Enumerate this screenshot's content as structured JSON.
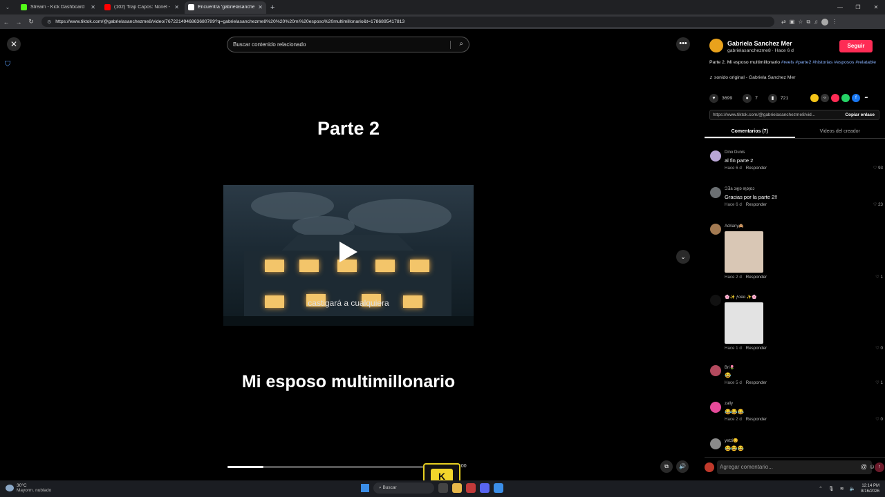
{
  "browser": {
    "tabs": [
      {
        "title": "Stream - Kick Dashboard",
        "color": "#53fc18",
        "active": false
      },
      {
        "title": "(102) Trap Capos: Noriel - Quie",
        "color": "#ff0000",
        "active": false
      },
      {
        "title": "Encuentra 'gabrielasanchezme8",
        "color": "#ffffff",
        "active": true
      }
    ],
    "url": "https://www.tiktok.com/@gabrielasanchezme8/video/7672214946863680789?q=gabrielasanchezme8%20%20%20mi%20esposo%20multimillonario&t=1786895417813"
  },
  "page": {
    "search_placeholder": "Buscar contenido relacionado",
    "video": {
      "title_top": "Parte 2",
      "subtitle": "castigará a cualquiera",
      "title_bottom": "Mi esposo multimillonario",
      "progress": 0.18,
      "time": "2:00"
    },
    "kick_badge": "K"
  },
  "panel": {
    "author_name": "Gabriela Sanchez Mer",
    "author_handle": "gabrielasanchezme8 · Hace 6 d",
    "follow_label": "Seguir",
    "desc_text": "Parte 2. Mi esposo multimillonario",
    "desc_tags": [
      "#reels",
      "#parte2",
      "#historias",
      "#esposos",
      "#relatable"
    ],
    "music": "sonido original - Gabriela Sanchez Mer",
    "likes": "3699",
    "comments_count": "7",
    "saves": "721",
    "link": "https://www.tiktok.com/@gabrielasanchezme8/vid...",
    "copy_label": "Copiar enlace",
    "tab_comments": "Comentarios (7)",
    "tab_creator": "Videos del creador",
    "reply_label": "Responder",
    "comments": [
      {
        "user": "Dino Dunis",
        "text": "al fin parte 2",
        "time": "Hace 6 d",
        "likes": "93",
        "avatar": "#b9a6d6"
      },
      {
        "user": "ϽƎa ɔʞɿɒ ɘɿɒɿɒɔ",
        "text": "Gracias por la parte 2!!",
        "time": "Hace 6 d",
        "likes": "23",
        "avatar": "#6b6f72"
      },
      {
        "user": "Adriany🙈",
        "text": "",
        "time": "Hace 2 d",
        "likes": "1",
        "avatar": "#a37a52",
        "sticker": "#d9c7b5"
      },
      {
        "user": "🌸✨ ƒαяα ✨🌸",
        "text": "",
        "time": "Hace 1 d",
        "likes": "0",
        "avatar": "#111111",
        "sticker": "#e3e3e3"
      },
      {
        "user": "Bri🌷",
        "text": "😂",
        "time": "Hace 5 d",
        "likes": "1",
        "avatar": "#b34a5e"
      },
      {
        "user": "zally",
        "text": "😂😂😂",
        "time": "Hace 2 d",
        "likes": "0",
        "avatar": "#e64a9a"
      },
      {
        "user": "yetzi😊",
        "text": "😂😂😂",
        "time": "",
        "likes": "",
        "avatar": "#8a8a8a"
      }
    ],
    "add_comment_placeholder": "Agregar comentario..."
  },
  "taskbar": {
    "temp": "30°C",
    "weather": "Mayorm. nublado",
    "search_label": "Buscar",
    "time": "12:14 PM",
    "date": "8/16/2026"
  }
}
